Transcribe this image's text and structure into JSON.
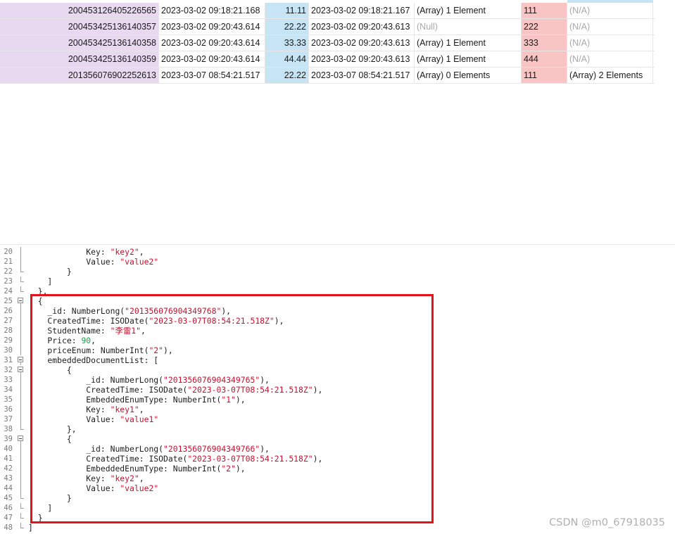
{
  "colors": {
    "id_column": "#e8d9f1",
    "price_column": "#c6e4f4",
    "enum_column": "#f8c4c4",
    "highlight_border": "#e3131b",
    "string_literal": "#c8102e",
    "number_literal": "#17a24a"
  },
  "grid": {
    "rows": [
      {
        "id": "200453126405226565",
        "created": "2023-03-02 09:18:21.168",
        "price": "11.11",
        "created2": "2023-03-02 09:18:21.167",
        "array": "(Array) 1 Element",
        "array_muted": false,
        "enum": "111",
        "embedded": "(N/A)",
        "embedded_muted": true
      },
      {
        "id": "200453425136140357",
        "created": "2023-03-02 09:20:43.614",
        "price": "22.22",
        "created2": "2023-03-02 09:20:43.613",
        "array": "(Null)",
        "array_muted": true,
        "enum": "222",
        "embedded": "(N/A)",
        "embedded_muted": true
      },
      {
        "id": "200453425136140358",
        "created": "2023-03-02 09:20:43.614",
        "price": "33.33",
        "created2": "2023-03-02 09:20:43.613",
        "array": "(Array) 1 Element",
        "array_muted": false,
        "enum": "333",
        "embedded": "(N/A)",
        "embedded_muted": true
      },
      {
        "id": "200453425136140359",
        "created": "2023-03-02 09:20:43.614",
        "price": "44.44",
        "created2": "2023-03-02 09:20:43.613",
        "array": "(Array) 1 Element",
        "array_muted": false,
        "enum": "444",
        "embedded": "(N/A)",
        "embedded_muted": true
      },
      {
        "id": "201356076902252613",
        "created": "2023-03-07 08:54:21.517",
        "price": "22.22",
        "created2": "2023-03-07 08:54:21.517",
        "array": "(Array) 0 Elements",
        "array_muted": false,
        "enum": "111",
        "embedded": "(Array) 2 Elements",
        "embedded_muted": false
      }
    ]
  },
  "editor": {
    "lines": [
      {
        "num": "20",
        "fold": "line",
        "parts": [
          [
            "t",
            "            Key: "
          ],
          [
            "s",
            "\"key2\""
          ],
          [
            "t",
            ","
          ]
        ]
      },
      {
        "num": "21",
        "fold": "line",
        "parts": [
          [
            "t",
            "            Value: "
          ],
          [
            "s",
            "\"value2\""
          ]
        ]
      },
      {
        "num": "22",
        "fold": "end",
        "parts": [
          [
            "t",
            "        }"
          ]
        ]
      },
      {
        "num": "23",
        "fold": "end",
        "parts": [
          [
            "t",
            "    ]"
          ]
        ]
      },
      {
        "num": "24",
        "fold": "end",
        "parts": [
          [
            "t",
            "  },"
          ]
        ]
      },
      {
        "num": "25",
        "fold": "box",
        "parts": [
          [
            "t",
            "  {"
          ]
        ]
      },
      {
        "num": "26",
        "fold": "line",
        "parts": [
          [
            "t",
            "    _id: NumberLong("
          ],
          [
            "s",
            "\"201356076904349768\""
          ],
          [
            "t",
            "),"
          ]
        ]
      },
      {
        "num": "27",
        "fold": "line",
        "parts": [
          [
            "t",
            "    CreatedTime: ISODate("
          ],
          [
            "s",
            "\"2023-03-07T08:54:21.518Z\""
          ],
          [
            "t",
            "),"
          ]
        ]
      },
      {
        "num": "28",
        "fold": "line",
        "parts": [
          [
            "t",
            "    StudentName: "
          ],
          [
            "s",
            "\"李雷1\""
          ],
          [
            "t",
            ","
          ]
        ]
      },
      {
        "num": "29",
        "fold": "line",
        "parts": [
          [
            "t",
            "    Price: "
          ],
          [
            "n",
            "90"
          ],
          [
            "t",
            ","
          ]
        ]
      },
      {
        "num": "30",
        "fold": "line",
        "parts": [
          [
            "t",
            "    priceEnum: NumberInt("
          ],
          [
            "s",
            "\"2\""
          ],
          [
            "t",
            "),"
          ]
        ]
      },
      {
        "num": "31",
        "fold": "box",
        "parts": [
          [
            "t",
            "    embeddedDocumentList: ["
          ]
        ]
      },
      {
        "num": "32",
        "fold": "box",
        "parts": [
          [
            "t",
            "        {"
          ]
        ]
      },
      {
        "num": "33",
        "fold": "line",
        "parts": [
          [
            "t",
            "            _id: NumberLong("
          ],
          [
            "s",
            "\"201356076904349765\""
          ],
          [
            "t",
            "),"
          ]
        ]
      },
      {
        "num": "34",
        "fold": "line",
        "parts": [
          [
            "t",
            "            CreatedTime: ISODate("
          ],
          [
            "s",
            "\"2023-03-07T08:54:21.518Z\""
          ],
          [
            "t",
            "),"
          ]
        ]
      },
      {
        "num": "35",
        "fold": "line",
        "parts": [
          [
            "t",
            "            EmbeddedEnumType: NumberInt("
          ],
          [
            "s",
            "\"1\""
          ],
          [
            "t",
            "),"
          ]
        ]
      },
      {
        "num": "36",
        "fold": "line",
        "parts": [
          [
            "t",
            "            Key: "
          ],
          [
            "s",
            "\"key1\""
          ],
          [
            "t",
            ","
          ]
        ]
      },
      {
        "num": "37",
        "fold": "line",
        "parts": [
          [
            "t",
            "            Value: "
          ],
          [
            "s",
            "\"value1\""
          ]
        ]
      },
      {
        "num": "38",
        "fold": "end",
        "parts": [
          [
            "t",
            "        },"
          ]
        ]
      },
      {
        "num": "39",
        "fold": "box",
        "parts": [
          [
            "t",
            "        {"
          ]
        ]
      },
      {
        "num": "40",
        "fold": "line",
        "parts": [
          [
            "t",
            "            _id: NumberLong("
          ],
          [
            "s",
            "\"201356076904349766\""
          ],
          [
            "t",
            "),"
          ]
        ]
      },
      {
        "num": "41",
        "fold": "line",
        "parts": [
          [
            "t",
            "            CreatedTime: ISODate("
          ],
          [
            "s",
            "\"2023-03-07T08:54:21.518Z\""
          ],
          [
            "t",
            "),"
          ]
        ]
      },
      {
        "num": "42",
        "fold": "line",
        "parts": [
          [
            "t",
            "            EmbeddedEnumType: NumberInt("
          ],
          [
            "s",
            "\"2\""
          ],
          [
            "t",
            "),"
          ]
        ]
      },
      {
        "num": "43",
        "fold": "line",
        "parts": [
          [
            "t",
            "            Key: "
          ],
          [
            "s",
            "\"key2\""
          ],
          [
            "t",
            ","
          ]
        ]
      },
      {
        "num": "44",
        "fold": "line",
        "parts": [
          [
            "t",
            "            Value: "
          ],
          [
            "s",
            "\"value2\""
          ]
        ]
      },
      {
        "num": "45",
        "fold": "end",
        "parts": [
          [
            "t",
            "        }"
          ]
        ]
      },
      {
        "num": "46",
        "fold": "end",
        "parts": [
          [
            "t",
            "    ]"
          ]
        ]
      },
      {
        "num": "47",
        "fold": "end",
        "parts": [
          [
            "t",
            "  }"
          ]
        ]
      },
      {
        "num": "48",
        "fold": "end",
        "parts": [
          [
            "t",
            "]"
          ]
        ]
      }
    ]
  },
  "watermark": "CSDN @m0_67918035"
}
